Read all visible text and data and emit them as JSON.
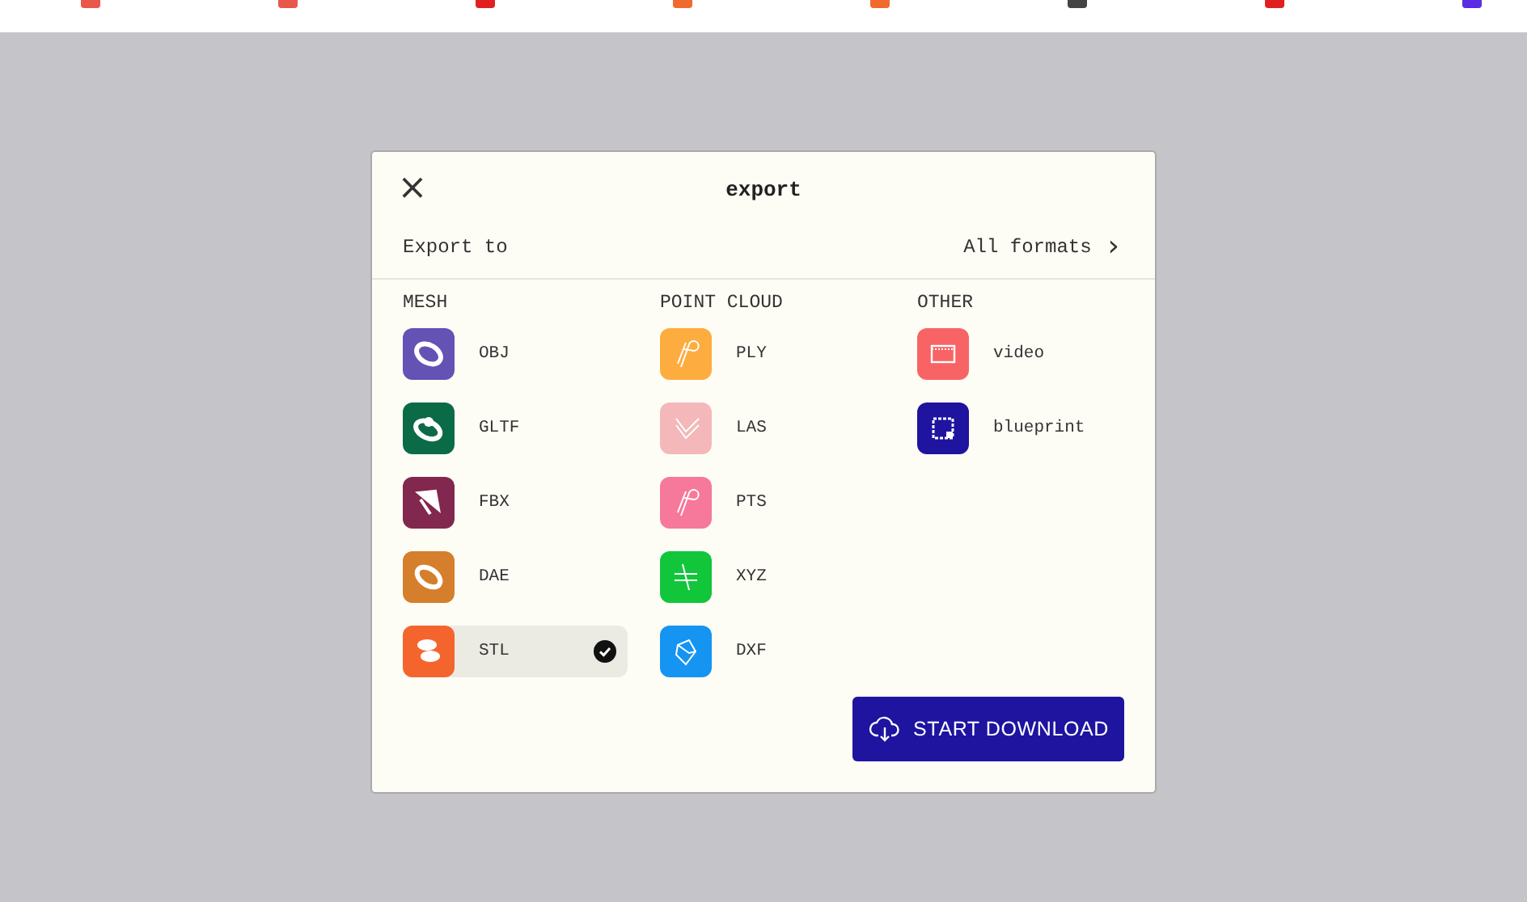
{
  "dialog": {
    "title": "export",
    "subtitle": "Export to",
    "all_formats": "All formats",
    "close": "×",
    "chevron": "›",
    "sections": [
      {
        "title": "MESH",
        "items": [
          {
            "label": "OBJ",
            "color": "#6552b5",
            "selected": false
          },
          {
            "label": "GLTF",
            "color": "#0c6b47",
            "selected": false
          },
          {
            "label": "FBX",
            "color": "#82284e",
            "selected": false
          },
          {
            "label": "DAE",
            "color": "#d57f2c",
            "selected": false
          },
          {
            "label": "STL",
            "color": "#f4652d",
            "selected": true
          }
        ]
      },
      {
        "title": "POINT CLOUD",
        "items": [
          {
            "label": "PLY",
            "color": "#fdad3f",
            "selected": false
          },
          {
            "label": "LAS",
            "color": "#f4b8ba",
            "selected": false
          },
          {
            "label": "PTS",
            "color": "#f6789b",
            "selected": false
          },
          {
            "label": "XYZ",
            "color": "#12c63c",
            "selected": false
          },
          {
            "label": "DXF",
            "color": "#1594f2",
            "selected": false
          }
        ]
      },
      {
        "title": "OTHER",
        "items": [
          {
            "label": "video",
            "color": "#f86465",
            "selected": false
          },
          {
            "label": "blueprint",
            "color": "#1e14a0",
            "selected": false
          }
        ]
      }
    ],
    "download": "START DOWNLOAD"
  }
}
